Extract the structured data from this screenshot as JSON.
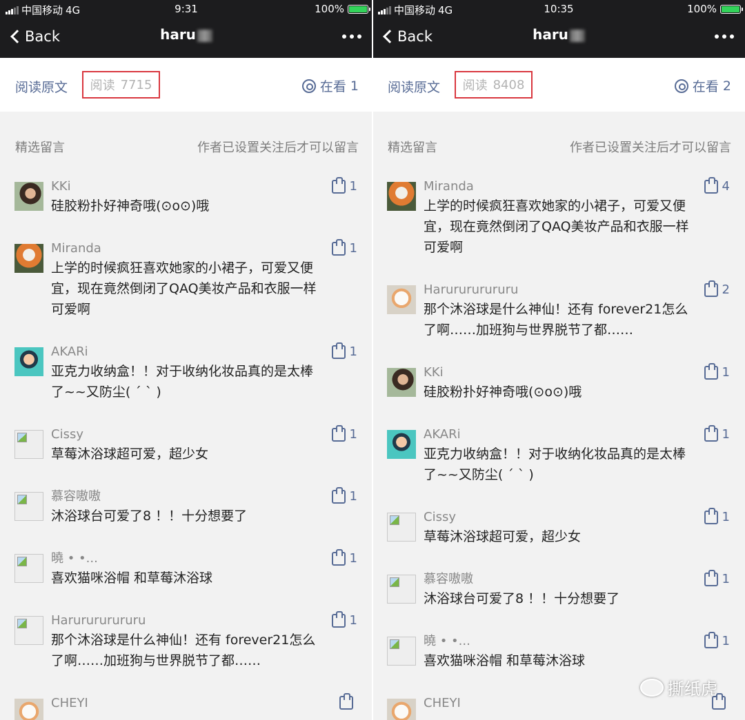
{
  "colors": {
    "link": "#576b95",
    "highlight_box": "#d9363e",
    "nav_bg": "#1c1c1e",
    "page_bg": "#f2f2f2"
  },
  "panels": [
    {
      "status": {
        "carrier": "中国移动",
        "network": "4G",
        "time": "9:31",
        "battery": "100%"
      },
      "nav": {
        "back": "Back",
        "title": "haru"
      },
      "readbar": {
        "origin": "阅读原文",
        "reads_label": "阅读",
        "reads_count": "7715",
        "zaikan_label": "在看",
        "zaikan_count": "1"
      },
      "section": {
        "left": "精选留言",
        "right": "作者已设置关注后才可以留言"
      },
      "comments": [
        {
          "name": "KKi",
          "avatar": "photo1",
          "likes": "1",
          "lines": [
            "硅胶粉扑好神奇哦(⊙o⊙)哦"
          ]
        },
        {
          "name": "  Miranda",
          "avatar": "photo2",
          "likes": "1",
          "lines": [
            "上学的时候疯狂喜欢她家的小裙子，可爱又便",
            "宜，现在竟然倒闭了QAQ美妆产品和衣服一样",
            "可爱啊"
          ]
        },
        {
          "name": "AKARi",
          "avatar": "photo3",
          "likes": "1",
          "lines": [
            "亚克力收纳盒！！对于收纳化妆品真的是太棒",
            "了~~又防尘(  ˊ      ˋ     )"
          ]
        },
        {
          "name": "Cissy",
          "avatar": "broken",
          "likes": "1",
          "lines": [
            "草莓沐浴球超可爱，超少女"
          ]
        },
        {
          "name": "慕容嗷嗷",
          "avatar": "broken",
          "likes": "1",
          "lines": [
            "沐浴球台可爱了8  ！！十分想要了"
          ]
        },
        {
          "name": "      曉        •  •...",
          "avatar": "broken",
          "likes": "1",
          "lines": [
            "喜欢猫咪浴帽    和草莓沐浴球"
          ]
        },
        {
          "name": "Harurururururu",
          "avatar": "broken",
          "likes": "1",
          "lines": [
            "那个沐浴球是什么神仙！还有 forever21怎么",
            "了啊……加班狗与世界脱节了都……"
          ]
        },
        {
          "name": "CHEYI",
          "avatar": "photo4",
          "likes": "",
          "lines": []
        }
      ]
    },
    {
      "status": {
        "carrier": "中国移动",
        "network": "4G",
        "time": "10:35",
        "battery": "100%"
      },
      "nav": {
        "back": "Back",
        "title": "haru"
      },
      "readbar": {
        "origin": "阅读原文",
        "reads_label": "阅读",
        "reads_count": "8408",
        "zaikan_label": "在看",
        "zaikan_count": "2"
      },
      "section": {
        "left": "精选留言",
        "right": "作者已设置关注后才可以留言"
      },
      "comments": [
        {
          "name": "  Miranda",
          "avatar": "photo2",
          "likes": "4",
          "lines": [
            "上学的时候疯狂喜欢她家的小裙子，可爱又便",
            "宜，现在竟然倒闭了QAQ美妆产品和衣服一样",
            "可爱啊"
          ]
        },
        {
          "name": "Harurururururu",
          "avatar": "photo4",
          "likes": "2",
          "lines": [
            "那个沐浴球是什么神仙！还有 forever21怎么",
            "了啊……加班狗与世界脱节了都……"
          ]
        },
        {
          "name": "KKi",
          "avatar": "photo1",
          "likes": "1",
          "lines": [
            "硅胶粉扑好神奇哦(⊙o⊙)哦"
          ]
        },
        {
          "name": "AKARi",
          "avatar": "photo3",
          "likes": "1",
          "lines": [
            "亚克力收纳盒！！对于收纳化妆品真的是太棒",
            "了~~又防尘(  ˊ      ˋ     )"
          ]
        },
        {
          "name": "Cissy",
          "avatar": "broken",
          "likes": "1",
          "lines": [
            "草莓沐浴球超可爱，超少女"
          ]
        },
        {
          "name": "慕容嗷嗷",
          "avatar": "broken",
          "likes": "1",
          "lines": [
            "沐浴球台可爱了8  ！！十分想要了"
          ]
        },
        {
          "name": "      曉        •  •...",
          "avatar": "broken",
          "likes": "1",
          "lines": [
            "喜欢猫咪浴帽    和草莓沐浴球"
          ]
        },
        {
          "name": "CHEYI",
          "avatar": "photo4",
          "likes": "",
          "lines": []
        }
      ]
    }
  ],
  "watermark": "撕纸虎"
}
